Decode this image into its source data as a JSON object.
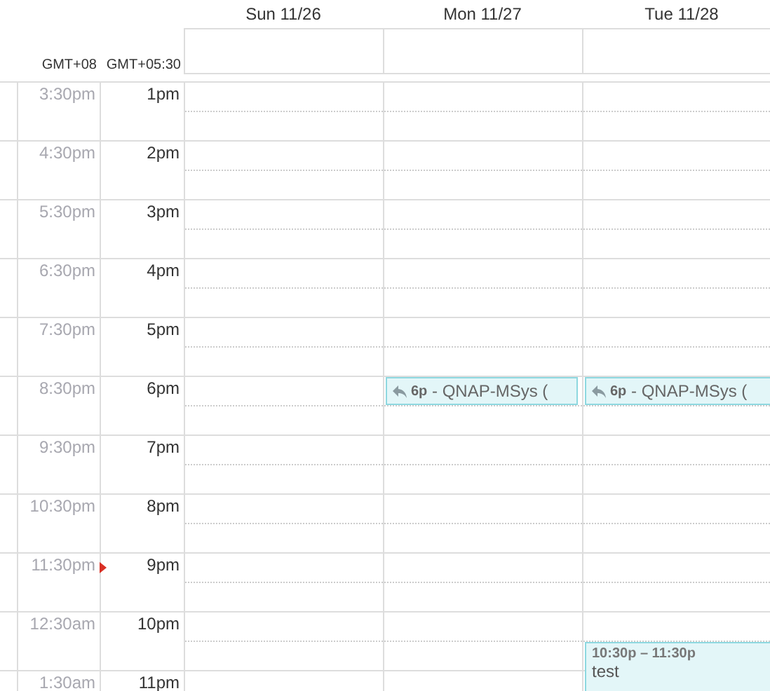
{
  "timezones": [
    "GMT+08",
    "GMT+05:30"
  ],
  "days": [
    "Sun 11/26",
    "Mon 11/27",
    "Tue 11/28"
  ],
  "hours": [
    {
      "primary": "3:30pm",
      "secondary": "1pm",
      "now": false,
      "cells": [
        {},
        {},
        {}
      ]
    },
    {
      "primary": "4:30pm",
      "secondary": "2pm",
      "now": false,
      "cells": [
        {},
        {},
        {}
      ]
    },
    {
      "primary": "5:30pm",
      "secondary": "3pm",
      "now": false,
      "cells": [
        {},
        {},
        {}
      ]
    },
    {
      "primary": "6:30pm",
      "secondary": "4pm",
      "now": false,
      "cells": [
        {},
        {},
        {}
      ]
    },
    {
      "primary": "7:30pm",
      "secondary": "5pm",
      "now": false,
      "cells": [
        {},
        {},
        {}
      ]
    },
    {
      "primary": "8:30pm",
      "secondary": "6pm",
      "now": false,
      "cells": [
        {},
        {
          "event": {
            "kind": "reminder",
            "time": "6p",
            "title": "- QNAP-MSys ("
          }
        },
        {
          "event": {
            "kind": "reminder",
            "time": "6p",
            "title": "- QNAP-MSys ("
          }
        }
      ]
    },
    {
      "primary": "9:30pm",
      "secondary": "7pm",
      "now": false,
      "cells": [
        {},
        {},
        {}
      ]
    },
    {
      "primary": "10:30pm",
      "secondary": "8pm",
      "now": false,
      "cells": [
        {},
        {},
        {}
      ]
    },
    {
      "primary": "11:30pm",
      "secondary": "9pm",
      "now": true,
      "cells": [
        {},
        {},
        {}
      ]
    },
    {
      "primary": "12:30am",
      "secondary": "10pm",
      "now": false,
      "cells": [
        {},
        {},
        {
          "event": {
            "kind": "block",
            "time": "10:30p – 11:30p",
            "title": "test"
          }
        }
      ]
    },
    {
      "primary": "1:30am",
      "secondary": "11pm",
      "now": false,
      "cells": [
        {},
        {},
        {}
      ]
    }
  ]
}
